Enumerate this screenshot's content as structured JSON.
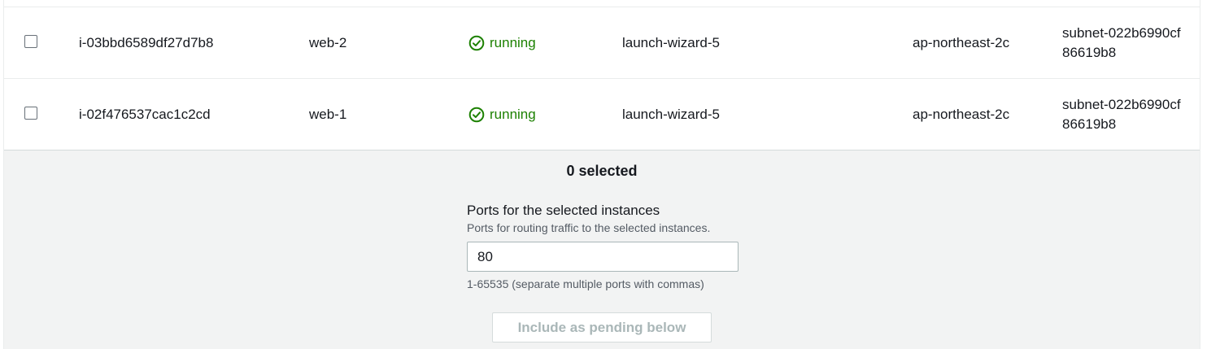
{
  "instances": [
    {
      "instance_id": "i-03bbd6589df27d7b8",
      "name": "web-2",
      "state": "running",
      "security_group": "launch-wizard-5",
      "availability_zone": "ap-northeast-2c",
      "subnet": "subnet-022b6990cf86619b8"
    },
    {
      "instance_id": "i-02f476537cac1c2cd",
      "name": "web-1",
      "state": "running",
      "security_group": "launch-wizard-5",
      "availability_zone": "ap-northeast-2c",
      "subnet": "subnet-022b6990cf86619b8"
    }
  ],
  "footer": {
    "selected_count": "0 selected",
    "ports_label": "Ports for the selected instances",
    "ports_description": "Ports for routing traffic to the selected instances.",
    "ports_value": "80",
    "ports_hint": "1-65535 (separate multiple ports with commas)",
    "include_button": "Include as pending below"
  },
  "colors": {
    "running": "#1d8102",
    "footer_bg": "#f2f3f3",
    "disabled_text": "#aab7b8"
  },
  "icons": {
    "state": "check-circle-icon",
    "row_select": "checkbox"
  }
}
